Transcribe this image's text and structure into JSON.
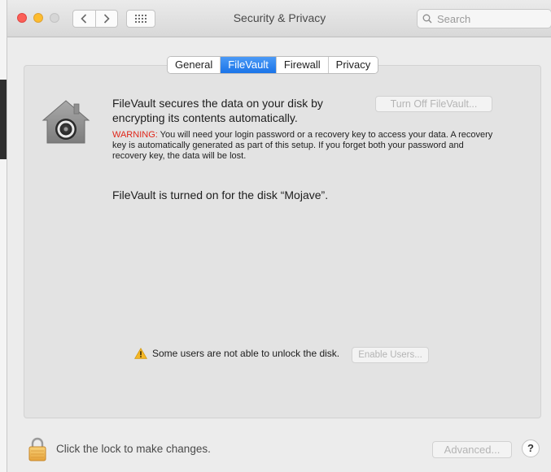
{
  "window": {
    "title": "Security & Privacy"
  },
  "toolbar": {
    "back_icon": "chevron-left-icon",
    "forward_icon": "chevron-right-icon",
    "show_all_icon": "grid-icon"
  },
  "search": {
    "placeholder": "Search"
  },
  "tabs": [
    {
      "label": "General",
      "active": false
    },
    {
      "label": "FileVault",
      "active": true
    },
    {
      "label": "Firewall",
      "active": false
    },
    {
      "label": "Privacy",
      "active": false
    }
  ],
  "filevault": {
    "description": "FileVault secures the data on your disk by encrypting its contents automatically.",
    "turn_off_label": "Turn Off FileVault...",
    "warning_label": "WARNING:",
    "warning_text": " You will need your login password or a recovery key to access your data. A recovery key is automatically generated as part of this setup. If you forget both your password and recovery key, the data will be lost.",
    "status": "FileVault is turned on for the disk “Mojave”.",
    "users_warning": "Some users are not able to unlock the disk.",
    "enable_users_label": "Enable Users..."
  },
  "footer": {
    "lock_text": "Click the lock to make changes.",
    "advanced_label": "Advanced...",
    "help_label": "?"
  },
  "colors": {
    "accent": "#1a74e8",
    "warning_red": "#e0261a",
    "close": "#fc5f57",
    "minimize": "#fdbc2e"
  }
}
